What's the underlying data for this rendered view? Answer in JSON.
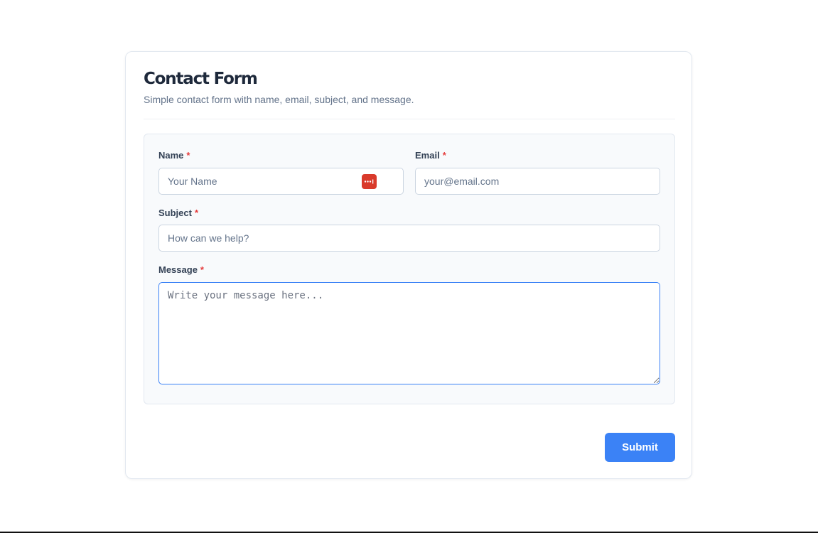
{
  "form": {
    "title": "Contact Form",
    "subtitle": "Simple contact form with name, email, subject, and message.",
    "required_marker": "*",
    "fields": {
      "name": {
        "label": "Name",
        "placeholder": "Your Name",
        "value": ""
      },
      "email": {
        "label": "Email",
        "placeholder": "your@email.com",
        "value": ""
      },
      "subject": {
        "label": "Subject",
        "placeholder": "How can we help?",
        "value": ""
      },
      "message": {
        "label": "Message",
        "placeholder": "Write your message here...",
        "value": ""
      }
    },
    "submit_label": "Submit"
  },
  "icons": {
    "password_manager": "password-manager-icon"
  },
  "colors": {
    "accent": "#3b82f6",
    "required": "#e53e3e",
    "password_manager": "#d93a2b",
    "title": "#1e293b",
    "muted": "#64748b"
  }
}
